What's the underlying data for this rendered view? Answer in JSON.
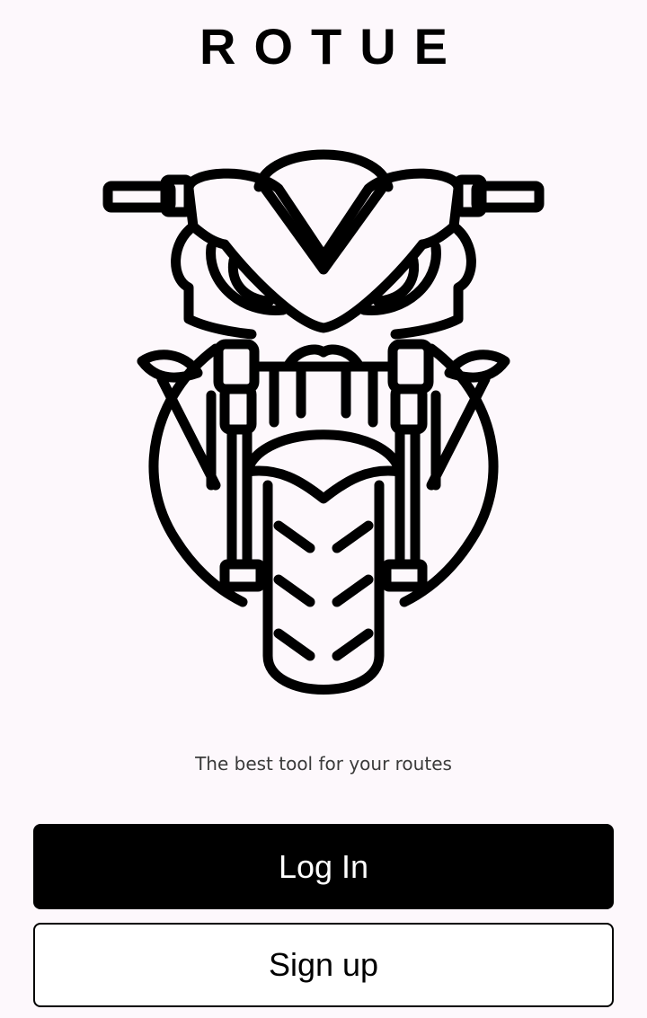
{
  "app": {
    "title": "ROTUE",
    "tagline": "The best tool for your routes"
  },
  "logo": {
    "icon": "motorcycle-front-icon"
  },
  "actions": {
    "login_label": "Log In",
    "signup_label": "Sign up"
  },
  "colors": {
    "background": "#fdf8fc",
    "primary": "#000000",
    "on_primary": "#ffffff",
    "tagline": "#3a3a3a"
  }
}
